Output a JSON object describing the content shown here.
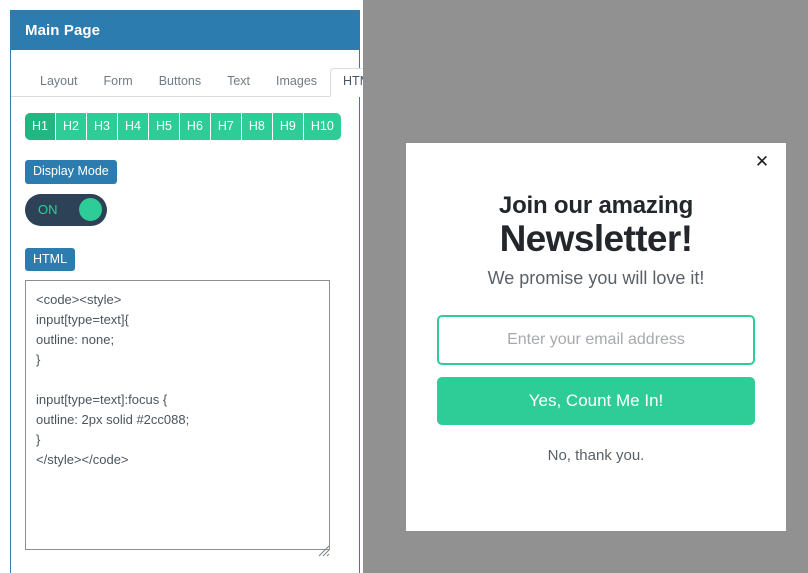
{
  "panel": {
    "header_title": "Main Page",
    "tabs": [
      {
        "label": "Layout",
        "active": false
      },
      {
        "label": "Form",
        "active": false
      },
      {
        "label": "Buttons",
        "active": false
      },
      {
        "label": "Text",
        "active": false
      },
      {
        "label": "Images",
        "active": false
      },
      {
        "label": "HTML",
        "active": true
      }
    ],
    "heading_buttons": [
      {
        "label": "H1",
        "active": true
      },
      {
        "label": "H2",
        "active": false
      },
      {
        "label": "H3",
        "active": false
      },
      {
        "label": "H4",
        "active": false
      },
      {
        "label": "H5",
        "active": false
      },
      {
        "label": "H6",
        "active": false
      },
      {
        "label": "H7",
        "active": false
      },
      {
        "label": "H8",
        "active": false
      },
      {
        "label": "H9",
        "active": false
      },
      {
        "label": "H10",
        "active": false
      }
    ],
    "display_mode_label": "Display Mode",
    "toggle_state": "ON",
    "html_label": "HTML",
    "code_value": "<code><style>\ninput[type=text]{\noutline: none;\n}\n\ninput[type=text]:focus {\noutline: 2px solid #2cc088;\n}\n</style></code>"
  },
  "modal": {
    "close_icon": "close-icon",
    "close_glyph": "✕",
    "title_line1": "Join our amazing",
    "title_line2": "Newsletter!",
    "subtitle": "We promise you will love it!",
    "email_placeholder": "Enter your email address",
    "email_value": "",
    "cta_label": "Yes, Count Me In!",
    "decline_label": "No, thank you."
  },
  "colors": {
    "header_blue": "#2d7cb0",
    "accent_green": "#2ecc96",
    "active_green": "#21b682",
    "toggle_navy": "#2d4257",
    "overlay_gray": "#919191"
  }
}
